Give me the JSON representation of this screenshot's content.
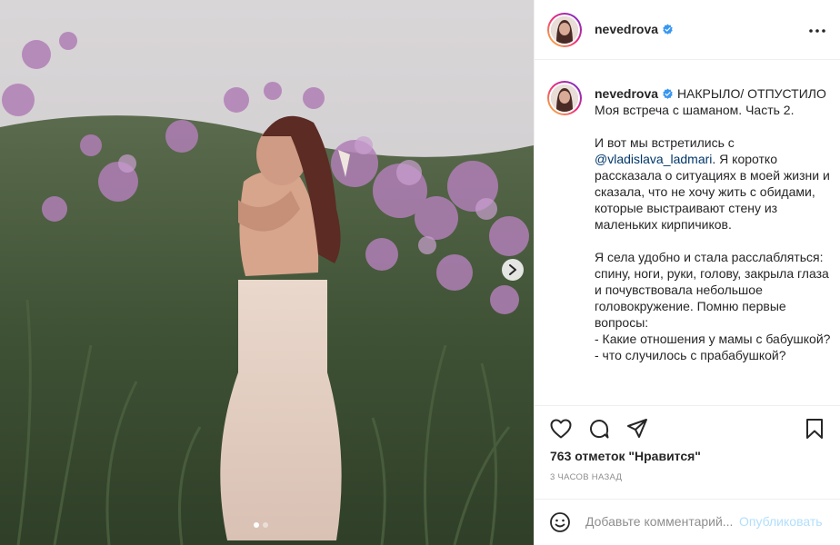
{
  "post": {
    "username": "nevedrova",
    "verified": true,
    "image_count": 2,
    "current_image": 1
  },
  "caption": {
    "username": "nevedrova",
    "title": "НАКРЫЛО/ ОТПУСТИЛО",
    "line2": "Моя встреча с шаманом. Часть 2.",
    "p2_before": "И вот мы встретились с ",
    "mention": "@vladislava_ladmari",
    "p2_after": ". Я коротко рассказала о ситуациях в моей жизни и сказала, что не хочу жить с обидами, которые выстраивают стену из маленьких кирпичиков.",
    "p3": "Я села удобно и стала расслабляться: спину, ноги, руки, голову, закрыла глаза и почувствовала небольшое головокружение. Помню первые вопросы:",
    "q1": "- Какие отношения у мамы с бабушкой?",
    "q2": "- что случилось с прабабушкой?"
  },
  "stats": {
    "likes": "763 отметок \"Нравится\"",
    "time": "3 ЧАСОВ НАЗАД"
  },
  "comment": {
    "placeholder": "Добавьте комментарий...",
    "post_label": "Опубликовать"
  },
  "icons": {
    "verified": "verified-badge-icon",
    "more": "more-horizontal-icon",
    "like": "heart-icon",
    "comment": "comment-icon",
    "share": "paper-plane-icon",
    "save": "bookmark-icon",
    "emoji": "smiley-icon",
    "next": "chevron-right-icon"
  },
  "colors": {
    "verified_blue": "#3897f0",
    "mention": "#00376b",
    "post_button_disabled": "#b2dffc",
    "muted": "#8e8e8e"
  }
}
